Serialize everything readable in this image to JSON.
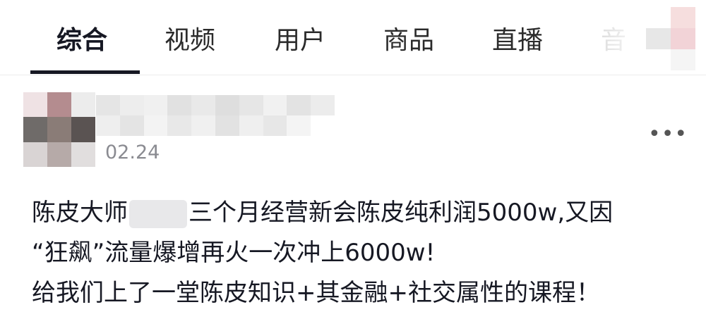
{
  "tabs": [
    {
      "label": "综合",
      "active": true
    },
    {
      "label": "视频",
      "active": false
    },
    {
      "label": "用户",
      "active": false
    },
    {
      "label": "商品",
      "active": false
    },
    {
      "label": "直播",
      "active": false
    },
    {
      "label": "音",
      "active": false
    }
  ],
  "post": {
    "date": "02.24",
    "more_label": "•••",
    "lines": [
      {
        "before": "陈皮大师",
        "after": "三个月经营新会陈皮纯利润5000w,又因"
      },
      {
        "text": "“狂飙”流量爆增再火一次冲上6000w!"
      },
      {
        "text": "给我们上了一堂陈皮知识+其金融+社交属性的课程！"
      }
    ]
  },
  "colors": {
    "text": "#161823",
    "muted": "#8a8b91",
    "divider": "#ececec"
  }
}
